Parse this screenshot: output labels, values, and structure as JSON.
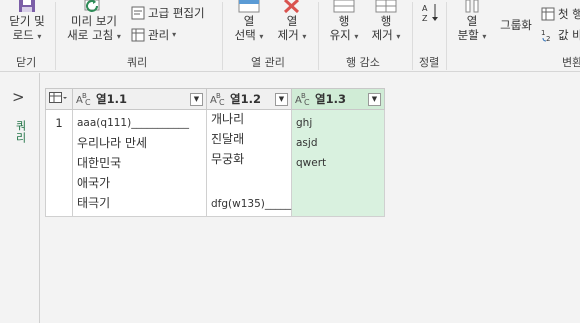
{
  "ribbon": {
    "close": {
      "label1": "닫기 및",
      "label2": "로드",
      "group": "닫기"
    },
    "query": {
      "preview_label1": "미리 보기",
      "preview_label2": "새로 고침",
      "advanced_editor": "고급 편집기",
      "manage": "관리",
      "group": "쿼리"
    },
    "columns": {
      "select_label1": "열",
      "select_label2": "선택",
      "remove_label1": "열",
      "remove_label2": "제거",
      "group": "열 관리"
    },
    "rows": {
      "keep_label1": "행",
      "keep_label2": "유지",
      "remove_label1": "행",
      "remove_label2": "제거",
      "group": "행 감소"
    },
    "sort": {
      "group": "정렬"
    },
    "transform": {
      "split_label1": "열",
      "split_label2": "분할",
      "groupby": "그룹화",
      "first_row": "첫 행",
      "replace": "값 바",
      "group": "변환"
    }
  },
  "leftpane": {
    "chevron": ">",
    "label": "쿼리"
  },
  "grid": {
    "columns": [
      "열1.1",
      "열1.2",
      "열1.3"
    ],
    "row_number": "1",
    "col1_lines": [
      "aaa(q111)___________",
      "우리나라 만세",
      "대한민국",
      "애국가",
      "태극기"
    ],
    "col2_lines": [
      "개나리",
      "진달래",
      "무궁화"
    ],
    "col2_bottom": "dfg(w135)_____",
    "col3_lines": [
      "ghj",
      "asjd",
      "qwert"
    ]
  },
  "colors": {
    "selected_column": "#d9f1df",
    "close_x": "#d9534f",
    "accent": "#217346"
  }
}
